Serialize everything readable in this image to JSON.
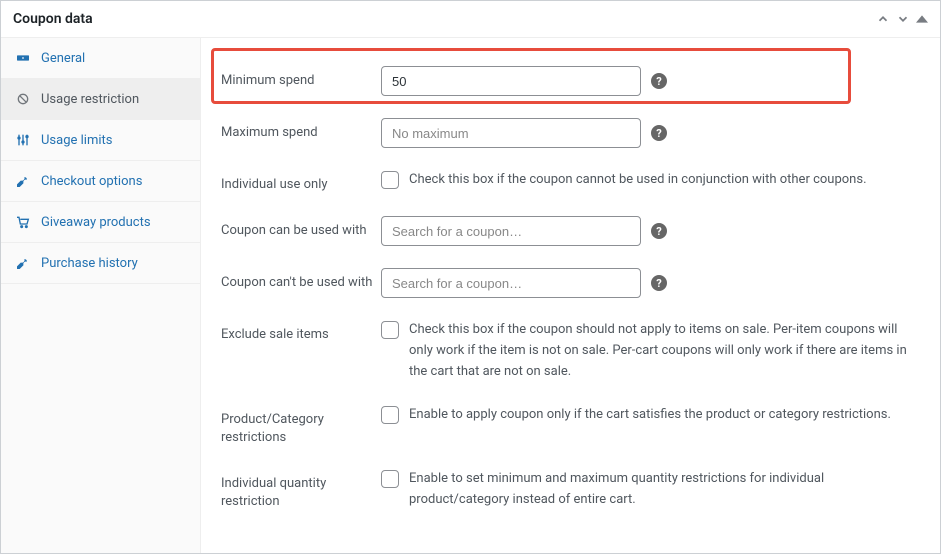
{
  "header": {
    "title": "Coupon data"
  },
  "sidebar": {
    "tabs": [
      {
        "label": "General"
      },
      {
        "label": "Usage restriction"
      },
      {
        "label": "Usage limits"
      },
      {
        "label": "Checkout options"
      },
      {
        "label": "Giveaway products"
      },
      {
        "label": "Purchase history"
      }
    ]
  },
  "form": {
    "min_spend": {
      "label": "Minimum spend",
      "value": "50"
    },
    "max_spend": {
      "label": "Maximum spend",
      "placeholder": "No maximum"
    },
    "individual_use": {
      "label": "Individual use only",
      "desc": "Check this box if the coupon cannot be used in conjunction with other coupons."
    },
    "can_use_with": {
      "label": "Coupon can be used with",
      "placeholder": "Search for a coupon…"
    },
    "cant_use_with": {
      "label": "Coupon can't be used with",
      "placeholder": "Search for a coupon…"
    },
    "exclude_sale": {
      "label": "Exclude sale items",
      "desc": "Check this box if the coupon should not apply to items on sale. Per-item coupons will only work if the item is not on sale. Per-cart coupons will only work if there are items in the cart that are not on sale."
    },
    "prod_cat_restrict": {
      "label": "Product/Category restrictions",
      "desc": "Enable to apply coupon only if the cart satisfies the product or category restrictions."
    },
    "indiv_qty_restrict": {
      "label": "Individual quantity restriction",
      "desc": "Enable to set minimum and maximum quantity restrictions for individual product/category instead of entire cart."
    },
    "help_char": "?"
  }
}
